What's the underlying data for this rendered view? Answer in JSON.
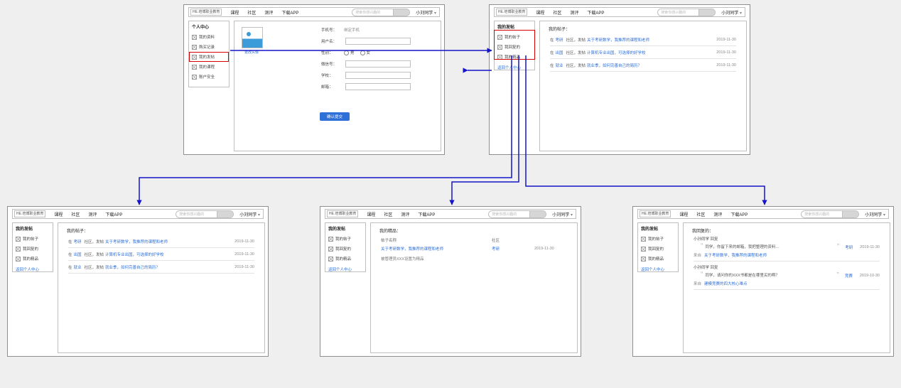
{
  "common": {
    "logo": "HE.培博职业教育",
    "nav": {
      "courses": "课程",
      "community": "社区",
      "assessment": "测评",
      "download": "下载APP"
    },
    "search_placeholder": "搜索你感兴趣的",
    "user": "小刘同学"
  },
  "profile": {
    "sidebar_title": "个人中心",
    "sidebar": {
      "info": "我的资料",
      "records": "购买记录",
      "posts": "我的发帖",
      "courses": "我的课程",
      "security": "账户安全"
    },
    "avatar_caption": "更改头像",
    "rows": {
      "phone_label": "手机号：",
      "phone_value": "绑定手机",
      "username_label": "用户名：",
      "gender_label": "性别：",
      "gender_male": "男",
      "gender_female": "女",
      "wechat_label": "微信号：",
      "school_label": "学校：",
      "email_label": "邮箱："
    },
    "submit": "确认提交"
  },
  "postsBlock": {
    "sidebar_title": "我的发帖",
    "sidebar": {
      "myposts": "我的帖子",
      "myreplies": "我回复的",
      "myelite": "我的精品"
    },
    "back_link": "返回个人中心",
    "list_title": "我的帖子：",
    "rows": [
      {
        "pre": "在",
        "cat": "考研",
        "mid": "社区，发帖",
        "title": "关于考研数学，我推荐的课程和老师",
        "date": "2019-11-30"
      },
      {
        "pre": "在",
        "cat": "出国",
        "mid": "社区，发帖",
        "title": "计算机专业出国，可选择的好学校",
        "date": "2019-11-30"
      },
      {
        "pre": "在",
        "cat": "就业",
        "mid": "社区，发帖",
        "title": "就业季，如何完善自己的简历？",
        "date": "2019-11-30"
      }
    ]
  },
  "elite": {
    "title": "我的精品：",
    "header": {
      "c1": "帖子名称",
      "c2": "社区",
      "c3": ""
    },
    "row": {
      "title": "关于考研数学，我推荐的课程和老师",
      "cat": "考研",
      "date": "2019-11-30"
    },
    "note": "被管理员XXX设置为精品"
  },
  "replies": {
    "title": "我回复的：",
    "items": [
      {
        "user": "小孙同学",
        "label": "回复",
        "bubble": "同学，你留下来的邮箱，我把整理的资料…",
        "cat": "考研",
        "date": "2019-11-30",
        "from_label": "来自",
        "from_link": "关于考研数学，我推荐的课程和老师"
      },
      {
        "user": "小孙同学",
        "label": "回复",
        "bubble": "同学，请问你的XXX书都是在哪里买的啊？",
        "cat": "竞赛",
        "date": "2019-10-30",
        "from_label": "来自",
        "from_link": "建模竞赛的四大核心难点"
      }
    ]
  }
}
